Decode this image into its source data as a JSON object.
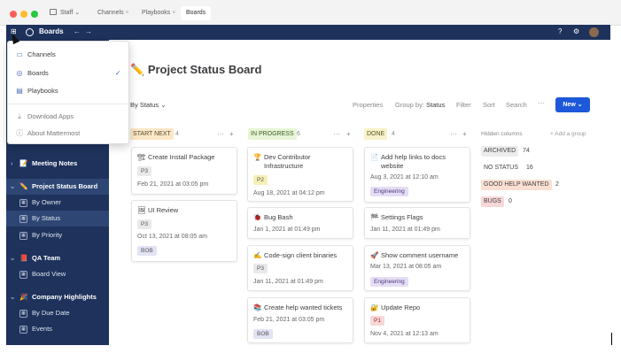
{
  "titlebar": {
    "team": "Staff",
    "tabs": [
      "Channels",
      "Playbooks",
      "Boards"
    ]
  },
  "header": {
    "title": "Boards"
  },
  "menu": {
    "items": [
      {
        "label": "Channels",
        "icon": "channels-icon"
      },
      {
        "label": "Boards",
        "icon": "boards-icon"
      },
      {
        "label": "Playbooks",
        "icon": "playbooks-icon"
      },
      {
        "label": "Download Apps",
        "icon": "download-icon"
      },
      {
        "label": "About Mattermost",
        "icon": "info-icon"
      }
    ]
  },
  "sidebar": {
    "items": [
      {
        "label": "Meeting Notes",
        "emoji": "📝"
      },
      {
        "label": "Project Status Board",
        "emoji": "✏️"
      },
      {
        "label": "By Owner"
      },
      {
        "label": "By Status"
      },
      {
        "label": "By Priority"
      },
      {
        "label": "QA Team",
        "emoji": "📕"
      },
      {
        "label": "Board View"
      },
      {
        "label": "Company Highlights",
        "emoji": "🎉"
      },
      {
        "label": "By Due Date"
      },
      {
        "label": "Events"
      }
    ]
  },
  "board": {
    "title": "Project Status Board",
    "emoji": "✏️",
    "view": "By Status",
    "toolbar": {
      "properties": "Properties",
      "group_by": "Group by:",
      "group_value": "Status",
      "filter": "Filter",
      "sort": "Sort",
      "search": "Search",
      "more": "···",
      "new": "New"
    },
    "columns": [
      {
        "name": "START NEXT",
        "count": "4"
      },
      {
        "name": "IN PROGRESS",
        "count": "6"
      },
      {
        "name": "DONE",
        "count": "4"
      }
    ],
    "hidden": {
      "label": "Hidden columns",
      "add_group": "+ Add a group",
      "items": [
        {
          "name": "ARCHIVED",
          "count": "74"
        },
        {
          "name": "NO STATUS",
          "count": "16"
        },
        {
          "name": "GOOD HELP WANTED",
          "count": "2"
        },
        {
          "name": "BUGS",
          "count": "0"
        }
      ]
    },
    "cards": {
      "c1": {
        "title": "Create Install Package",
        "pill": "P3",
        "date": "Feb 21, 2021 at 03:05 pm",
        "emoji": "🏗"
      },
      "c2": {
        "title": "UI Review",
        "pill": "P3",
        "date": "Oct 13, 2021 at 08:05 am",
        "tag": "BOB",
        "emoji": "🖼"
      },
      "c3": {
        "title1": "Dev Contributor",
        "title2": "Infrastructure",
        "pill": "P2",
        "date": "Aug 18, 2021 at 04:12 pm",
        "emoji": "🏆"
      },
      "c4": {
        "title": "Bug Bash",
        "date": "Jan 1, 2021 at 01:49 pm",
        "emoji": "🐞"
      },
      "c5": {
        "title": "Code-sign client binaries",
        "pill": "P3",
        "date": "Jan 11, 2021 at 01:49 pm",
        "emoji": "✍"
      },
      "c6": {
        "title": "Create help wanted tickets",
        "date": "Feb 21, 2021 at 03:05 pm",
        "tag": "BOB",
        "emoji": "📚"
      },
      "c7": {
        "title1": "Add help links to docs",
        "title2": "website",
        "date": "Aug 3, 2021 at 12:10 am",
        "tag": "Engineering",
        "emoji": "📄"
      },
      "c8": {
        "title": "Settings Flags",
        "date": "Jan 11, 2021 at 01:49 pm",
        "emoji": "🏁"
      },
      "c9": {
        "title": "Show comment username",
        "date": "Mar 13, 2021 at 08:05 am",
        "tag": "Engineering",
        "emoji": "🚀"
      },
      "c10": {
        "title": "Update Repo",
        "pill": "P1",
        "date": "Nov 4, 2021 at 12:13 am",
        "emoji": "🔐"
      }
    }
  },
  "colors": {
    "header": "#1e325c",
    "sidebar": "#1e325c",
    "accent": "#1c58d9",
    "start_next": "#fbe7c6",
    "in_progress": "#e7f5d6",
    "done": "#f7f2c9",
    "engineering": "#e5dcf5",
    "bob": "#e2e3f3",
    "p1": "#f8d7d7",
    "p2": "#f7f0b6"
  }
}
